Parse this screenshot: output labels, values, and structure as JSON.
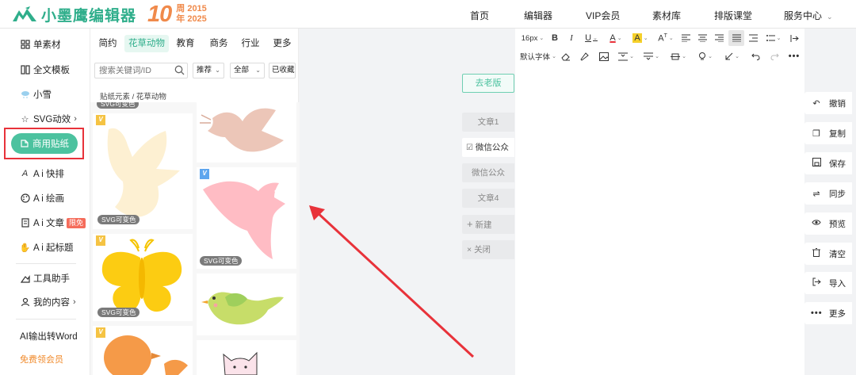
{
  "brand": {
    "name": "小墨鹰编辑器",
    "anniversary_number": "10",
    "anniversary_line1": "周 2015",
    "anniversary_line2": "年 2025",
    "color": "#2fae8b",
    "anniv_color": "#f08a4b"
  },
  "topnav": {
    "items": [
      {
        "label": "首页"
      },
      {
        "label": "编辑器"
      },
      {
        "label": "VIP会员"
      },
      {
        "label": "素材库"
      },
      {
        "label": "排版课堂"
      },
      {
        "label": "服务中心"
      }
    ]
  },
  "sidebar": {
    "items": [
      {
        "label": "单素材",
        "icon": "grid-icon"
      },
      {
        "label": "全文模板",
        "icon": "template-icon"
      },
      {
        "label": "小雪",
        "icon": "snow-cloud-icon"
      },
      {
        "label": "SVG动效",
        "icon": "star-icon",
        "arrow": "›"
      },
      {
        "label": "商用贴纸",
        "icon": "sticker-icon",
        "active": true
      },
      {
        "label": "A i 快排",
        "icon": "ai-icon"
      },
      {
        "label": "A i 绘画",
        "icon": "palette-icon"
      },
      {
        "label": "A i 文章",
        "icon": "doc-icon",
        "badge": "限免"
      },
      {
        "label": "A i 起标题",
        "icon": "hand-icon"
      },
      {
        "label": "工具助手",
        "icon": "tools-icon"
      },
      {
        "label": "我的内容",
        "icon": "user-icon",
        "arrow": "›"
      },
      {
        "label": "AI输出转Word"
      }
    ],
    "free_vip": "免费领会员",
    "accent": "#4cc29f",
    "highlight_color": "#e8323a"
  },
  "sticker_panel": {
    "tabs": [
      "简约",
      "花草动物",
      "教育",
      "商务",
      "行业",
      "更多"
    ],
    "active_tab": "花草动物",
    "search_placeholder": "搜索关键词/ID",
    "filters": [
      {
        "label": "推荐"
      },
      {
        "label": "全部"
      },
      {
        "label": "已收藏"
      }
    ],
    "breadcrumb": "贴纸元素 / 花草动物",
    "vip_mark": "V",
    "svg_tag": "SVG可变色"
  },
  "articles": {
    "old_version": "去老版",
    "tabs": [
      {
        "label": "文章1"
      },
      {
        "label": "微信公众"
      },
      {
        "label": "微信公众"
      },
      {
        "label": "文章4"
      }
    ],
    "new_label": "新建",
    "close_label": "关闭"
  },
  "editor_toolbar": {
    "font_size": "16px",
    "font_family": "默认字体",
    "text_color": "#e8323a",
    "highlight_color": "#f5d02a"
  },
  "right_actions": [
    {
      "label": "撤销",
      "icon": "undo-icon"
    },
    {
      "label": "复制",
      "icon": "copy-icon"
    },
    {
      "label": "保存",
      "icon": "save-icon"
    },
    {
      "label": "同步",
      "icon": "sync-icon"
    },
    {
      "label": "预览",
      "icon": "eye-icon"
    },
    {
      "label": "清空",
      "icon": "trash-icon"
    },
    {
      "label": "导入",
      "icon": "import-icon"
    },
    {
      "label": "更多",
      "icon": "more-icon"
    }
  ],
  "annotation": {
    "arrow_color": "#e8323a"
  }
}
